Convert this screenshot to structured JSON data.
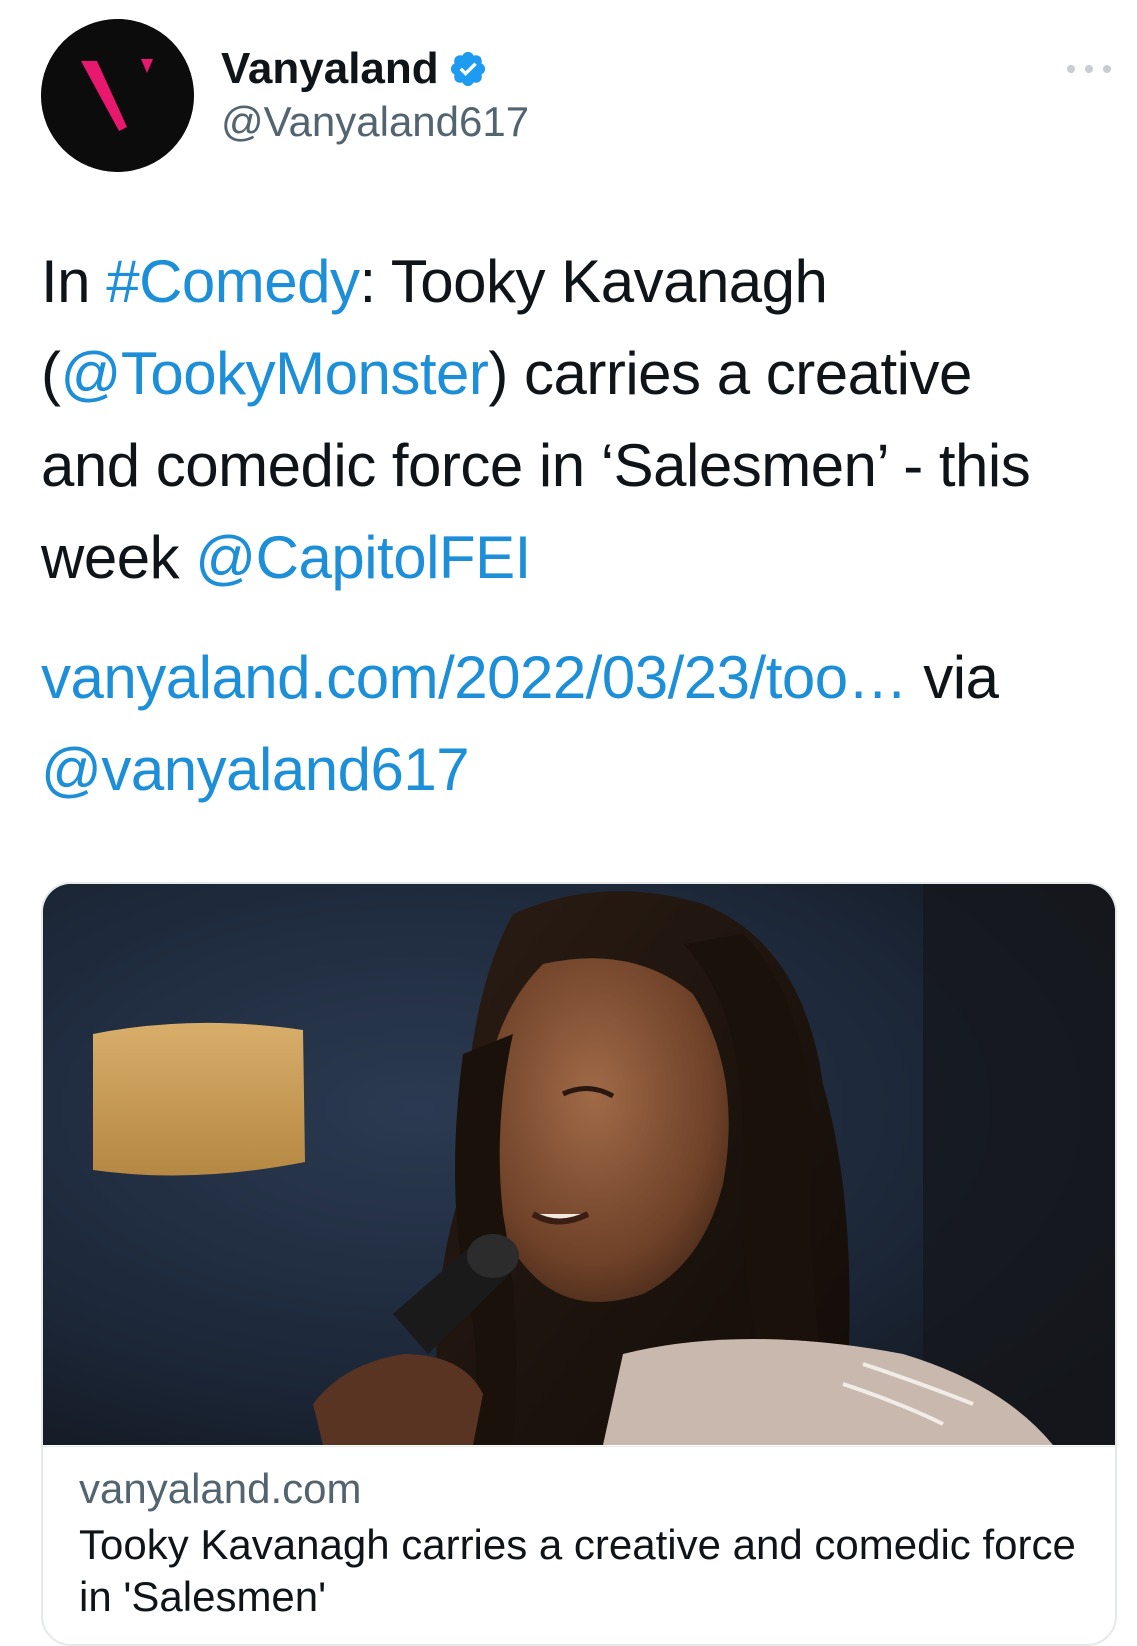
{
  "header": {
    "display_name": "Vanyaland",
    "handle": "@Vanyaland617",
    "verified": true,
    "avatar_icon": "vanyaland-v-logo-icon",
    "more_icon": "more-dots-icon"
  },
  "tweet": {
    "line1": {
      "pre": "In ",
      "hashtag": "#Comedy",
      "post": ": Tooky Kavanagh"
    },
    "line2": {
      "pre": "(",
      "mention": "@TookyMonster",
      "post": ") carries a creative"
    },
    "line3": {
      "text": "and comedic force in ‘Salesmen’ - this"
    },
    "line4": {
      "pre": "week ",
      "mention": "@CapitolFEI"
    },
    "link_line": {
      "url": "vanyaland.com/2022/03/23/too…",
      "post": " via"
    },
    "via_mention": "@vanyaland617"
  },
  "card": {
    "domain": "vanyaland.com",
    "title": "Tooky Kavanagh carries a creative and comedic force in 'Salesmen'",
    "image_icon": "performer-photo"
  },
  "colors": {
    "link": "#1d8fd8",
    "text": "#0f1419",
    "secondary": "#536471",
    "verified": "#1d9bf0",
    "logo_pink": "#e8186e"
  }
}
